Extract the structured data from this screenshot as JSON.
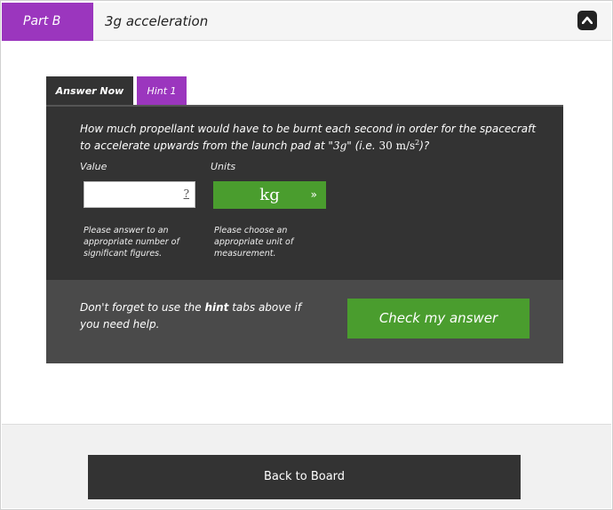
{
  "header": {
    "part_label": "Part B",
    "title": "3g acceleration",
    "collapse_icon": "chevron-up-icon"
  },
  "tabs": [
    {
      "label": "Answer Now",
      "active": true
    },
    {
      "label": "Hint 1",
      "active": false
    }
  ],
  "question": {
    "text_1": "How much propellant would have to be burnt each second in order for the spacecraft to accelerate upwards from the launch pad at \"",
    "accel": "3g",
    "text_2": "\" (i.e. ",
    "value": "30",
    "unit": "m/s",
    "unit_exp": "2",
    "text_3": ")?"
  },
  "form": {
    "value_label": "Value",
    "units_label": "Units",
    "value_input": "",
    "value_help_mark": "?",
    "units_selected": "kg",
    "units_chevron": "»",
    "value_help": "Please answer to an appropriate number of significant figures.",
    "units_help": "Please choose an appropriate unit of measurement."
  },
  "footer": {
    "reminder_1": "Don't forget to use the ",
    "reminder_bold": "hint",
    "reminder_2": " tabs above if you need help.",
    "check_label": "Check my answer"
  },
  "bottom": {
    "back_label": "Back to Board"
  },
  "colors": {
    "accent_purple": "#9b36be",
    "accent_green": "#4a9d2e",
    "panel_dark": "#333333",
    "panel_footer": "#4a4a4a"
  }
}
